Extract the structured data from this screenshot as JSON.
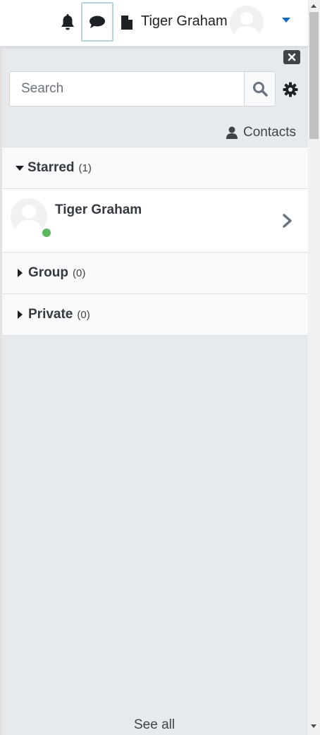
{
  "navbar": {
    "user_name": "Tiger Graham",
    "icons": [
      "bell-icon",
      "message-icon",
      "document-icon",
      "caret-down-icon"
    ],
    "accent_color": "#0f6cbf"
  },
  "drawer": {
    "search": {
      "placeholder": "Search",
      "value": ""
    },
    "contacts_label": "Contacts",
    "sections": {
      "starred": {
        "label": "Starred",
        "count": "(1)",
        "expanded": true
      },
      "group": {
        "label": "Group",
        "count": "(0)",
        "expanded": false
      },
      "private": {
        "label": "Private",
        "count": "(0)",
        "expanded": false
      }
    },
    "starred_contacts": [
      {
        "name": "Tiger Graham",
        "status": "online",
        "status_color": "#5cb85c"
      }
    ],
    "see_all": "See all"
  }
}
